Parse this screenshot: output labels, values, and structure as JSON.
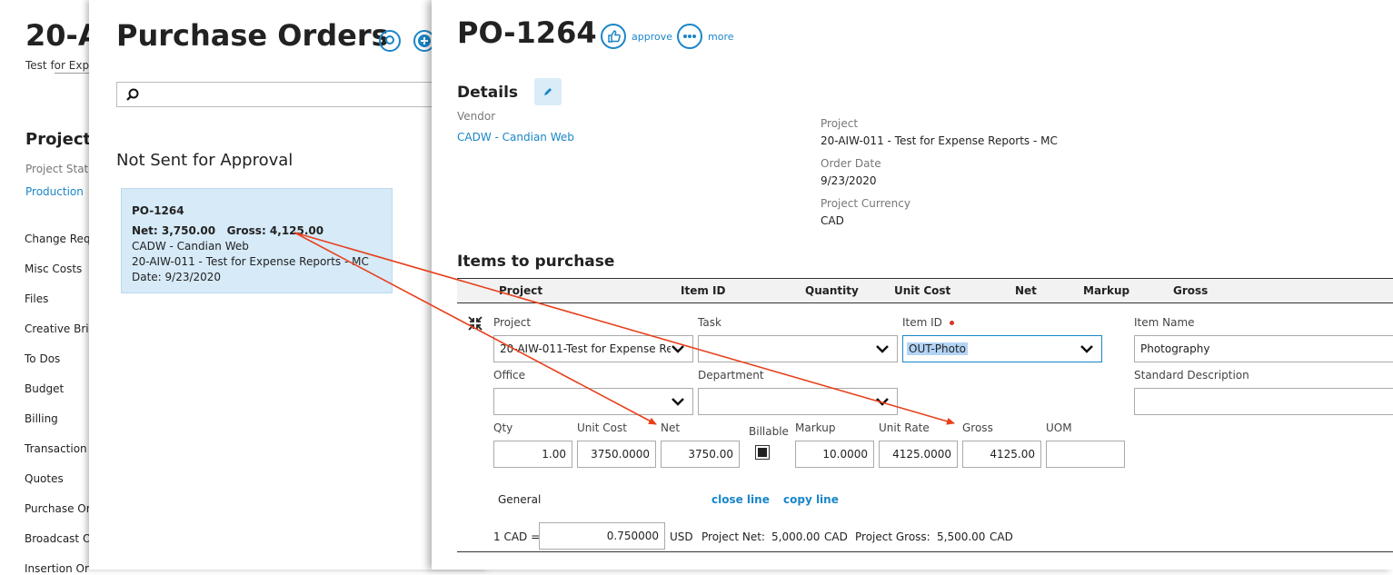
{
  "project_page": {
    "title": "20-A",
    "subtitle": "Test for Expe",
    "section_title": "Project I",
    "status_label": "Project Statu",
    "status_value": "Production",
    "nav": [
      "Change Requ",
      "Misc Costs",
      "Files",
      "Creative Brie",
      "To Dos",
      "Budget",
      "Billing",
      "Transaction",
      "Quotes",
      "Purchase Or",
      "Broadcast O",
      "Insertion Or"
    ]
  },
  "po_list": {
    "title": "Purchase Orders",
    "search_placeholder": "",
    "group_title": "Not Sent for Approval",
    "card": {
      "id": "PO-1264",
      "net_gross": "Net: 3,750.00   Gross: 4,125.00",
      "vendor": "CADW - Candian Web",
      "project": "20-AIW-011 - Test for Expense Reports - MC",
      "date": "Date: 9/23/2020"
    }
  },
  "po_detail": {
    "title": "PO-1264",
    "approve_label": "approve",
    "more_label": "more",
    "details_heading": "Details",
    "vendor_label": "Vendor",
    "vendor_value": "CADW - Candian Web",
    "project_label": "Project",
    "project_value": "20-AIW-011 - Test for Expense Reports - MC",
    "order_date_label": "Order Date",
    "order_date_value": "9/23/2020",
    "currency_label": "Project Currency",
    "currency_value": "CAD",
    "items_heading": "Items to purchase",
    "table_headers": [
      "Project",
      "Item ID",
      "Quantity",
      "Unit Cost",
      "Net",
      "Markup",
      "Gross"
    ],
    "line": {
      "project_label": "Project",
      "project_value": "20-AIW-011-Test for Expense Rep",
      "task_label": "Task",
      "task_value": "",
      "item_id_label": "Item ID",
      "item_id_value": "OUT-Photo",
      "item_name_label": "Item Name",
      "item_name_value": "Photography",
      "office_label": "Office",
      "office_value": "",
      "department_label": "Department",
      "department_value": "",
      "std_desc_label": "Standard Description",
      "std_desc_value": "",
      "qty_label": "Qty",
      "qty_value": "1.00",
      "unit_cost_label": "Unit Cost",
      "unit_cost_value": "3750.0000",
      "net_label": "Net",
      "net_value": "3750.00",
      "billable_label": "Billable",
      "markup_label": "Markup",
      "markup_value": "10.0000",
      "unit_rate_label": "Unit Rate",
      "unit_rate_value": "4125.0000",
      "gross_label": "Gross",
      "gross_value": "4125.00",
      "uom_label": "UOM",
      "uom_value": "",
      "general_label": "General",
      "close_line": "close line",
      "copy_line": "copy line"
    },
    "footer": {
      "rate_prefix": "1 CAD =",
      "rate_value": "0.750000",
      "rate_currency": "USD",
      "project_net_label": "Project Net:",
      "project_net_value": "5,000.00",
      "project_net_currency": "CAD",
      "project_gross_label": "Project Gross:",
      "project_gross_value": "5,500.00",
      "project_gross_currency": "CAD"
    }
  },
  "colors": {
    "accent": "#1a86c8",
    "card_bg": "#d6eaf8",
    "arrow": "#e8401c",
    "required": "#d9342b"
  }
}
